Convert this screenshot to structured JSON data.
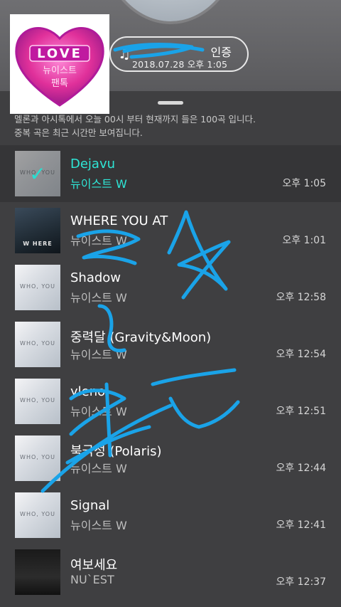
{
  "header": {
    "auth_label": "인증",
    "auth_date": "2018.07.28 오후 1:05"
  },
  "logo": {
    "main": "LOVE",
    "sub1": "뉴이스트",
    "sub2": "팬톡"
  },
  "sheet": {
    "info_line1": "멜론과 아시톡에서 오늘 00시 부터 현재까지 들은 100곡 입니다.",
    "info_line2": "중복 곡은 최근 시간만 보여집니다."
  },
  "songs": [
    {
      "title": "Dejavu",
      "artist": "뉴이스트 W",
      "time": "오후 1:05",
      "art": "WHO, YOU"
    },
    {
      "title": "WHERE YOU AT",
      "artist": "뉴이스트 W",
      "time": "오후 1:01",
      "art": "W HERE"
    },
    {
      "title": "Shadow",
      "artist": "뉴이스트 W",
      "time": "오후 12:58",
      "art": "WHO, YOU"
    },
    {
      "title": "중력달 (Gravity&Moon)",
      "artist": "뉴이스트 W",
      "time": "오후 12:54",
      "art": "WHO, YOU"
    },
    {
      "title": "ylenol",
      "artist": "뉴이스트 W",
      "time": "오후 12:51",
      "art": "WHO, YOU"
    },
    {
      "title": "북극성 (Polaris)",
      "artist": "뉴이스트 W",
      "time": "오후 12:44",
      "art": "WHO, YOU"
    },
    {
      "title": "Signal",
      "artist": "뉴이스트 W",
      "time": "오후 12:41",
      "art": "WHO, YOU"
    },
    {
      "title": "여보세요",
      "artist": "NU`EST",
      "time": "오후 12:37",
      "art": ""
    }
  ],
  "colors": {
    "playing_accent": "#2ee6d6",
    "scribble": "#1aa3e8",
    "logo_pink": "#e0309a"
  }
}
